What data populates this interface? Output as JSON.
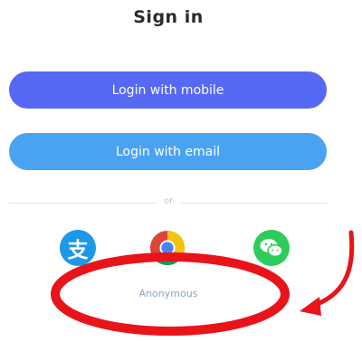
{
  "page": {
    "title": "Sign in"
  },
  "buttons": {
    "mobile_label": "Login with mobile",
    "email_label": "Login with email"
  },
  "divider": {
    "label": "or"
  },
  "social": {
    "alipay_glyph": "支",
    "icons": [
      "alipay-icon",
      "chrome-icon",
      "wechat-icon"
    ]
  },
  "anonymous": {
    "label": "Anonymous"
  },
  "colors": {
    "mobile_button": "#5569f4",
    "email_button": "#4aa2f2",
    "alipay": "#1c98e8",
    "wechat": "#2ecc5b",
    "annotation": "#e8141a",
    "anonymous_text": "#8ca3cb"
  }
}
